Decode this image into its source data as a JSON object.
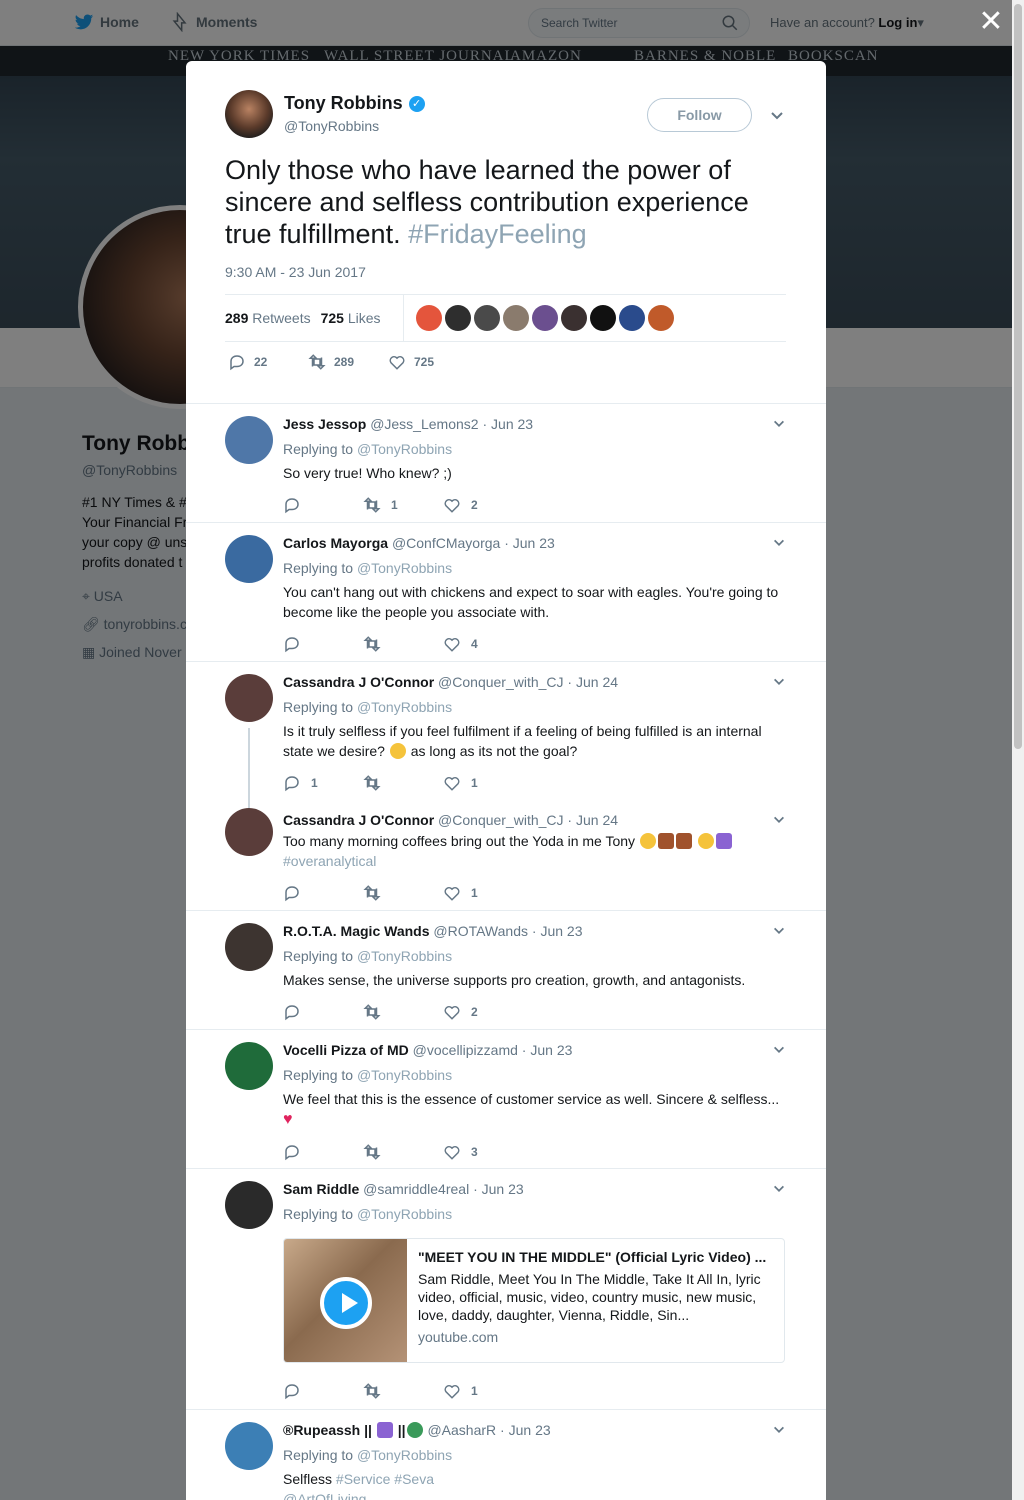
{
  "nav": {
    "home": "Home",
    "moments": "Moments",
    "search_placeholder": "Search Twitter",
    "account_prompt": "Have an account?",
    "login": "Log in"
  },
  "banner": {
    "labels": [
      "NEW YORK TIMES",
      "WALL STREET JOURNAL",
      "AMAZON",
      "BARNES & NOBLE",
      "BOOKSCAN"
    ]
  },
  "profile": {
    "name": "Tony Robb",
    "handle": "@TonyRobbins",
    "bio_lines": [
      "#1 NY Times & #",
      "Your Financial Fr",
      "your copy @ uns",
      "profits donated t"
    ],
    "location": "USA",
    "website": "tonyrobbins.c",
    "joined": "Joined Nover"
  },
  "tweet": {
    "name": "Tony Robbins",
    "handle": "@TonyRobbins",
    "follow_label": "Follow",
    "text": "Only those who have learned the power of sincere and selfless contribution experience true fulfillment. ",
    "hashtag": "#FridayFeeling",
    "timestamp": "9:30 AM - 23 Jun 2017",
    "retweets_count": "289",
    "retweets_label": "Retweets",
    "likes_count": "725",
    "likes_label": "Likes",
    "actions": {
      "replies": "22",
      "retweets": "289",
      "likes": "725"
    }
  },
  "replies": [
    {
      "name": "Jess Jessop",
      "handle": "@Jess_Lemons2",
      "date": "Jun 23",
      "replying_prefix": "Replying to",
      "replying_to": "@TonyRobbins",
      "text": "So very true! Who knew? ;)",
      "reply_count": "",
      "retweet_count": "1",
      "like_count": "2",
      "avatar_color": "#4f77a8"
    },
    {
      "name": "Carlos Mayorga",
      "handle": "@ConfCMayorga",
      "date": "Jun 23",
      "replying_prefix": "Replying to",
      "replying_to": "@TonyRobbins",
      "text": "You can't hang out with chickens and expect to soar with eagles. You're going to become like the people you associate with.",
      "reply_count": "",
      "retweet_count": "",
      "like_count": "4",
      "avatar_color": "#3a6aa0"
    },
    {
      "name": "Cassandra J O'Connor",
      "handle": "@Conquer_with_CJ",
      "date": "Jun 24",
      "replying_prefix": "Replying to",
      "replying_to": "@TonyRobbins",
      "text_before": "Is it truly selfless if you feel fulfilment if a feeling of being fulfilled is an internal state we desire? ",
      "text_after": " as long as its not the goal?",
      "reply_count": "1",
      "retweet_count": "",
      "like_count": "1",
      "avatar_color": "#5a3d3a"
    },
    {
      "name": "Cassandra J O'Connor",
      "handle": "@Conquer_with_CJ",
      "date": "Jun 24",
      "text": "Too many morning coffees bring out the Yoda in me Tony ",
      "hashtag": "#overanalytical",
      "reply_count": "",
      "retweet_count": "",
      "like_count": "1",
      "avatar_color": "#5a3d3a"
    },
    {
      "name": "R.O.T.A. Magic Wands",
      "handle": "@ROTAWands",
      "date": "Jun 23",
      "replying_prefix": "Replying to",
      "replying_to": "@TonyRobbins",
      "text": "Makes sense, the universe supports pro creation, growth, and antagonists.",
      "reply_count": "",
      "retweet_count": "",
      "like_count": "2",
      "avatar_color": "#3d3430"
    },
    {
      "name": "Vocelli Pizza of MD",
      "handle": "@vocellipizzamd",
      "date": "Jun 23",
      "replying_prefix": "Replying to",
      "replying_to": "@TonyRobbins",
      "text": "We feel that this is the essence of customer service as well. Sincere & selfless...",
      "reply_count": "",
      "retweet_count": "",
      "like_count": "3",
      "avatar_color": "#1f6b3a"
    },
    {
      "name": "Sam Riddle",
      "handle": "@samriddle4real",
      "date": "Jun 23",
      "replying_prefix": "Replying to",
      "replying_to": "@TonyRobbins",
      "card_title": "\"MEET YOU IN THE MIDDLE\" (Official Lyric Video) ...",
      "card_desc": "Sam Riddle, Meet You In The Middle, Take It All In, lyric video, official, music, video, country music, new music, love, daddy, daughter, Vienna, Riddle, Sin...",
      "card_domain": "youtube.com",
      "reply_count": "",
      "retweet_count": "",
      "like_count": "1",
      "avatar_color": "#2a2a2a"
    },
    {
      "name": "®Rupeassh ||",
      "name_after": " ||",
      "handle": "@AasharR",
      "date": "Jun 23",
      "replying_prefix": "Replying to",
      "replying_to": "@TonyRobbins",
      "text": "Selfless ",
      "hashtags": "#Service #Seva",
      "mention": "@ArtOfLiving",
      "avatar_color": "#3c7fb5"
    }
  ],
  "colors": {
    "accent": "#1da1f2",
    "link_muted": "#8ea4b3",
    "text_muted": "#657786"
  }
}
